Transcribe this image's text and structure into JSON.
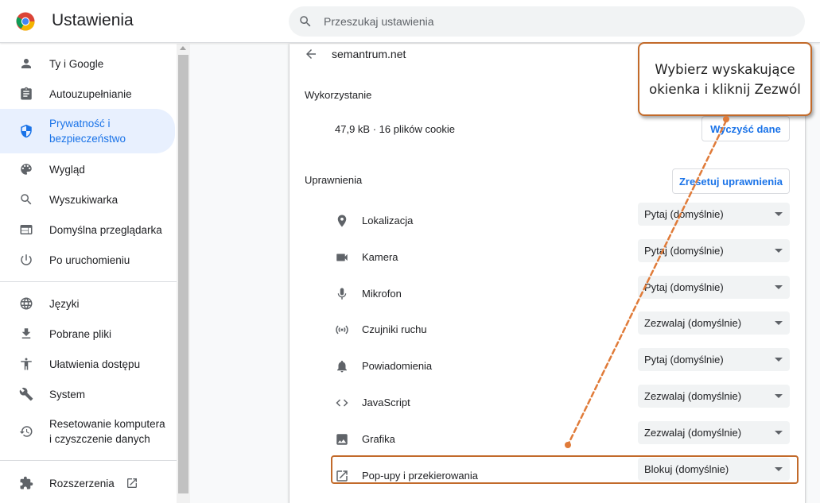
{
  "header": {
    "title": "Ustawienia",
    "search_placeholder": "Przeszukaj ustawienia"
  },
  "sidebar": {
    "items": [
      {
        "label": "Ty i Google",
        "icon": "person-icon"
      },
      {
        "label": "Autouzupełnianie",
        "icon": "clipboard-icon"
      },
      {
        "label": "Prywatność i bezpieczeństwo",
        "icon": "shield-icon",
        "active": true
      },
      {
        "label": "Wygląd",
        "icon": "palette-icon"
      },
      {
        "label": "Wyszukiwarka",
        "icon": "search-icon"
      },
      {
        "label": "Domyślna przeglądarka",
        "icon": "browser-icon"
      },
      {
        "label": "Po uruchomieniu",
        "icon": "power-icon"
      },
      {
        "label": "Języki",
        "icon": "globe-icon"
      },
      {
        "label": "Pobrane pliki",
        "icon": "download-icon"
      },
      {
        "label": "Ułatwienia dostępu",
        "icon": "accessibility-icon"
      },
      {
        "label": "System",
        "icon": "wrench-icon"
      },
      {
        "label": "Resetowanie komputera i czyszczenie danych",
        "icon": "history-icon"
      },
      {
        "label": "Rozszerzenia",
        "icon": "puzzle-icon"
      }
    ]
  },
  "main": {
    "site": "semantrum.net",
    "usage": {
      "title": "Wykorzystanie",
      "text": "47,9 kB · 16 plików cookie",
      "button": "Wyczyść dane"
    },
    "permissions": {
      "title": "Uprawnienia",
      "reset_button": "Zresetuj uprawnienia",
      "rows": [
        {
          "label": "Lokalizacja",
          "value": "Pytaj (domyślnie)",
          "icon": "location-icon"
        },
        {
          "label": "Kamera",
          "value": "Pytaj (domyślnie)",
          "icon": "camera-icon"
        },
        {
          "label": "Mikrofon",
          "value": "Pytaj (domyślnie)",
          "icon": "microphone-icon"
        },
        {
          "label": "Czujniki ruchu",
          "value": "Zezwalaj (domyślnie)",
          "icon": "sensors-icon"
        },
        {
          "label": "Powiadomienia",
          "value": "Pytaj (domyślnie)",
          "icon": "bell-icon"
        },
        {
          "label": "JavaScript",
          "value": "Zezwalaj (domyślnie)",
          "icon": "code-icon"
        },
        {
          "label": "Grafika",
          "value": "Zezwalaj (domyślnie)",
          "icon": "image-icon"
        },
        {
          "label": "Pop-upy i przekierowania",
          "value": "Blokuj (domyślnie)",
          "icon": "open-in-new-icon"
        }
      ]
    }
  },
  "annotation": {
    "text": "Wybierz wyskakujące okienka i kliknij Zezwól",
    "color": "#c26a2a",
    "arrow_color": "#e07b39"
  },
  "colors": {
    "accent": "#1a73e8",
    "active_bg": "#e8f0fe"
  }
}
